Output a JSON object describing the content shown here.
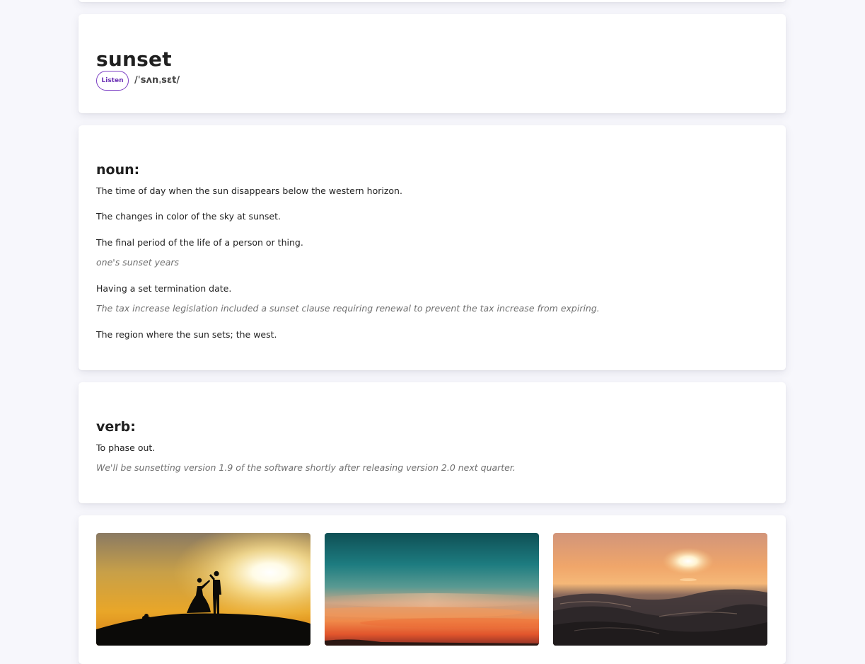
{
  "entry": {
    "word": "sunset",
    "listen_label": "Listen",
    "phonetic": "/ˈsʌnˌsɛt/"
  },
  "noun": {
    "label": "noun:",
    "definitions": [
      {
        "text": "The time of day when the sun disappears below the western horizon."
      },
      {
        "text": "The changes in color of the sky at sunset."
      },
      {
        "text": "The final period of the life of a person or thing.",
        "example": "one's sunset years"
      },
      {
        "text": "Having a set termination date.",
        "example": "The tax increase legislation included a sunset clause requiring renewal to prevent the tax increase from expiring."
      },
      {
        "text": "The region where the sun sets; the west."
      }
    ]
  },
  "verb": {
    "label": "verb:",
    "definitions": [
      {
        "text": "To phase out.",
        "example": "We'll be sunsetting version 1.9 of the software shortly after releasing version 2.0 next quarter."
      }
    ]
  },
  "images": [
    {
      "subject": "couple-silhouette-sunset-photo"
    },
    {
      "subject": "teal-orange-sky-photo"
    },
    {
      "subject": "ocean-waves-sunset-photo"
    }
  ],
  "colors": {
    "accent": "#7b3fc4",
    "background": "#f7f7fc",
    "card": "#ffffff",
    "example_text": "#6f6f6f"
  }
}
